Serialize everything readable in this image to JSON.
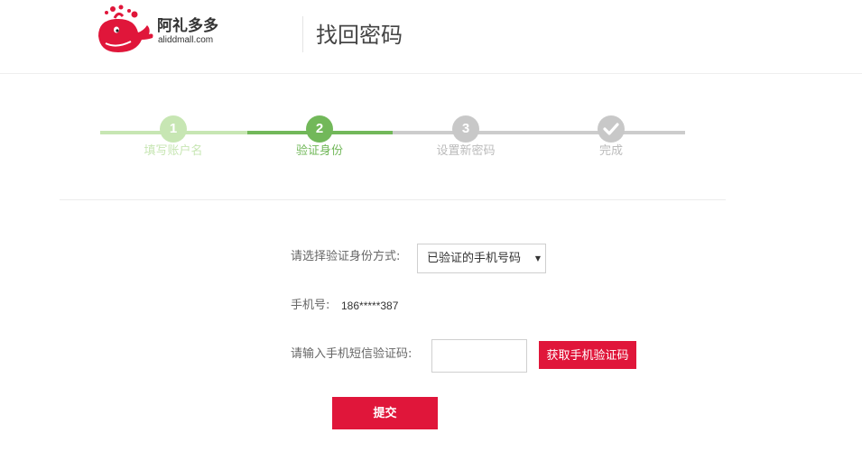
{
  "header": {
    "logo_title": "阿礼多多",
    "logo_subtitle": "aliddmall.com",
    "page_title": "找回密码"
  },
  "steps": [
    {
      "number": "1",
      "label": "填写账户名",
      "status": "done"
    },
    {
      "number": "2",
      "label": "验证身份",
      "status": "active"
    },
    {
      "number": "3",
      "label": "设置新密码",
      "status": "pending"
    },
    {
      "number": "✓",
      "label": "完成",
      "status": "pending"
    }
  ],
  "form": {
    "method_label": "请选择验证身份方式:",
    "method_value": "已验证的手机号码",
    "phone_label": "手机号:",
    "phone_value": "186*****387",
    "code_label": "请输入手机短信验证码:",
    "code_value": "",
    "get_code_label": "获取手机验证码",
    "submit_label": "提交"
  },
  "colors": {
    "brand_red": "#e0163a",
    "step_done": "#c7e6b3",
    "step_active": "#72b85a",
    "step_pending": "#c8c8c8"
  }
}
